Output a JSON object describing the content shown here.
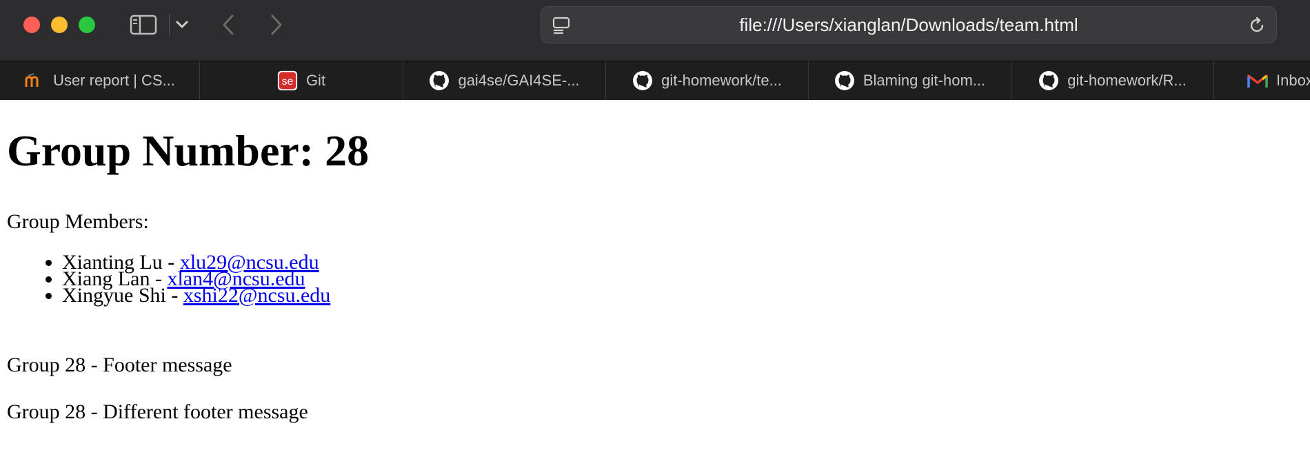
{
  "browser": {
    "url": "file:///Users/xianglan/Downloads/team.html",
    "tabs": [
      {
        "label": "User report | CS...",
        "icon": "moodle-icon"
      },
      {
        "label": "Git",
        "icon": "se-icon"
      },
      {
        "label": "gai4se/GAI4SE-...",
        "icon": "github-icon"
      },
      {
        "label": "git-homework/te...",
        "icon": "github-icon"
      },
      {
        "label": "Blaming git-hom...",
        "icon": "github-icon"
      },
      {
        "label": "git-homework/R...",
        "icon": "github-icon"
      },
      {
        "label": "Inbox",
        "icon": "gmail-icon"
      }
    ]
  },
  "page": {
    "heading": "Group Number: 28",
    "members_label": "Group Members:",
    "members": [
      {
        "name": "Xianting Lu - ",
        "email": "xlu29@ncsu.edu"
      },
      {
        "name": "Xiang Lan - ",
        "email": "xlan4@ncsu.edu"
      },
      {
        "name": "Xingyue Shi - ",
        "email": "xshi22@ncsu.edu"
      }
    ],
    "footer_1": "Group 28 - Footer message",
    "footer_2": "Group 28 - Different footer message"
  },
  "colors": {
    "toolbar": "#2d2d2f",
    "tabbar": "#1e1e1e",
    "link": "#0000ee",
    "traffic_red": "#ff5f57",
    "traffic_yellow": "#febc2e",
    "traffic_green": "#28c840"
  }
}
